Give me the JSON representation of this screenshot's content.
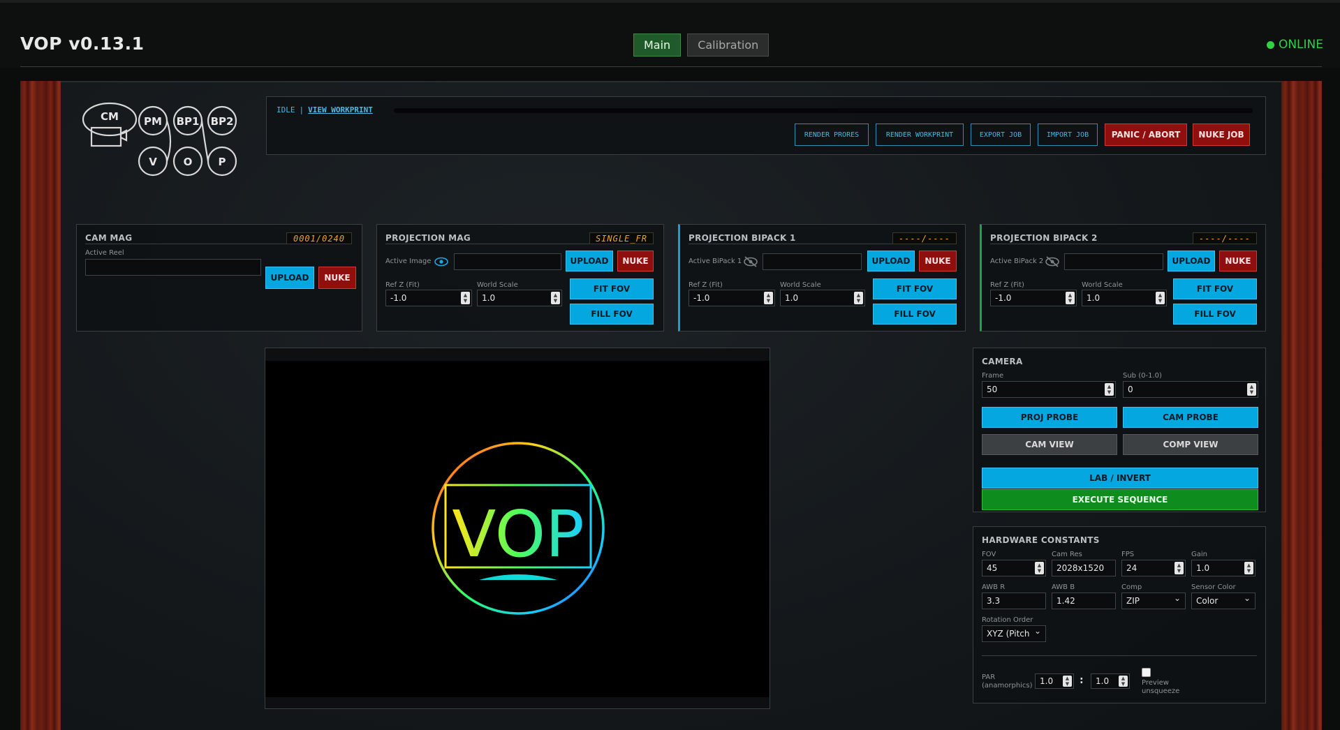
{
  "header": {
    "title": "VOP v0.13.1",
    "tabs": [
      {
        "label": "Main"
      },
      {
        "label": "Calibration"
      }
    ],
    "status": "ONLINE"
  },
  "logo": {
    "circles": [
      "CM",
      "PM",
      "BP1",
      "BP2",
      "V",
      "O",
      "P"
    ]
  },
  "toolbar": {
    "state": "IDLE",
    "sep": "|",
    "view_workprint": "VIEW WORKPRINT",
    "buttons": {
      "render_prores": "RENDER PRORES",
      "render_workprint": "RENDER WORKPRINT",
      "export_job": "EXPORT JOB",
      "import_job": "IMPORT JOB",
      "panic": "PANIC / ABORT",
      "nuke_job": "NUKE JOB"
    }
  },
  "cam_mag": {
    "title": "CAM MAG",
    "counter": "0001/0240",
    "active_label": "Active Reel",
    "active_value": "",
    "upload": "UPLOAD",
    "nuke": "NUKE"
  },
  "proj_mag": {
    "title": "PROJECTION MAG",
    "counter": "SINGLE_FR",
    "active_label": "Active Image",
    "active_value": "",
    "upload": "UPLOAD",
    "nuke": "NUKE",
    "refz_label": "Ref Z (Fit)",
    "refz": "-1.0",
    "ws_label": "World Scale",
    "ws": "1.0",
    "fit": "FIT FOV",
    "fill": "FILL FOV"
  },
  "bipack1": {
    "title": "PROJECTION BIPACK 1",
    "counter": "----/----",
    "active_label": "Active BiPack 1",
    "active_value": "",
    "upload": "UPLOAD",
    "nuke": "NUKE",
    "refz_label": "Ref Z (Fit)",
    "refz": "-1.0",
    "ws_label": "World Scale",
    "ws": "1.0",
    "fit": "FIT FOV",
    "fill": "FILL FOV"
  },
  "bipack2": {
    "title": "PROJECTION BIPACK 2",
    "counter": "----/----",
    "active_label": "Active BiPack 2",
    "active_value": "",
    "upload": "UPLOAD",
    "nuke": "NUKE",
    "refz_label": "Ref Z (Fit)",
    "refz": "-1.0",
    "ws_label": "World Scale",
    "ws": "1.0",
    "fit": "FIT FOV",
    "fill": "FILL FOV"
  },
  "viewport": {
    "logo_text": "VOP"
  },
  "camera": {
    "title": "CAMERA",
    "frame_label": "Frame",
    "frame": "50",
    "sub_label": "Sub (0-1.0)",
    "sub": "0",
    "proj_probe": "PROJ PROBE",
    "cam_probe": "CAM PROBE",
    "cam_view": "CAM VIEW",
    "comp_view": "COMP VIEW",
    "lab_invert": "LAB / INVERT",
    "execute": "EXECUTE SEQUENCE"
  },
  "hw": {
    "title": "HARDWARE CONSTANTS",
    "fov_label": "FOV",
    "fov": "45",
    "camres_label": "Cam Res",
    "camres": "2028x1520",
    "fps_label": "FPS",
    "fps": "24",
    "gain_label": "Gain",
    "gain": "1.0",
    "awbr_label": "AWB R",
    "awbr": "3.3",
    "awbb_label": "AWB B",
    "awbb": "1.42",
    "comp_label": "Comp",
    "comp": "ZIP",
    "sensor_label": "Sensor Color",
    "sensor": "Color",
    "rot_label": "Rotation Order",
    "rot": "XYZ (Pitch",
    "par_label1": "PAR",
    "par_label2": "(anamorphics)",
    "par_a": "1.0",
    "par_colon": ":",
    "par_b": "1.0",
    "preview_label1": "Preview",
    "preview_label2": "unsqueeze"
  },
  "colors": {
    "accent": "#05a7e0",
    "danger": "#8f0f0f",
    "go": "#0e8d1e",
    "online": "#2fd23f",
    "lcd": "#f0a42a"
  }
}
